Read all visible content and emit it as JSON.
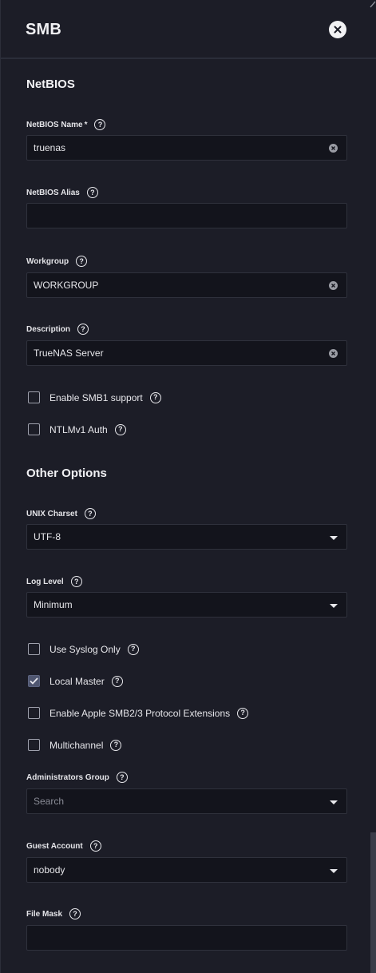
{
  "header": {
    "title": "SMB"
  },
  "sections": {
    "netbios": "NetBIOS",
    "other": "Other Options"
  },
  "fields": {
    "netbios_name": {
      "label": "NetBIOS Name",
      "required_mark": "*",
      "value": "truenas"
    },
    "netbios_alias": {
      "label": "NetBIOS Alias",
      "value": ""
    },
    "workgroup": {
      "label": "Workgroup",
      "value": "WORKGROUP"
    },
    "description": {
      "label": "Description",
      "value": "TrueNAS Server"
    },
    "unix_charset": {
      "label": "UNIX Charset",
      "value": "UTF-8"
    },
    "log_level": {
      "label": "Log Level",
      "value": "Minimum"
    },
    "admin_group": {
      "label": "Administrators Group",
      "placeholder": "Search"
    },
    "guest_account": {
      "label": "Guest Account",
      "value": "nobody"
    },
    "file_mask": {
      "label": "File Mask",
      "value": ""
    }
  },
  "checkboxes": {
    "smb1": {
      "label": "Enable SMB1 support",
      "checked": false
    },
    "ntlmv1": {
      "label": "NTLMv1 Auth",
      "checked": false
    },
    "syslog": {
      "label": "Use Syslog Only",
      "checked": false
    },
    "local_master": {
      "label": "Local Master",
      "checked": true
    },
    "apple_ext": {
      "label": "Enable Apple SMB2/3 Protocol Extensions",
      "checked": false
    },
    "multichannel": {
      "label": "Multichannel",
      "checked": false
    }
  },
  "help_glyph": "?",
  "icons": {
    "close": "close-icon",
    "clear": "clear-icon",
    "dropdown": "chevron-down-icon",
    "help": "help-icon",
    "check": "check-icon"
  },
  "colors": {
    "background": "#1c1d27",
    "input_bg": "#13141c",
    "text": "#e6e6ea",
    "checked_box": "#4f5670"
  }
}
